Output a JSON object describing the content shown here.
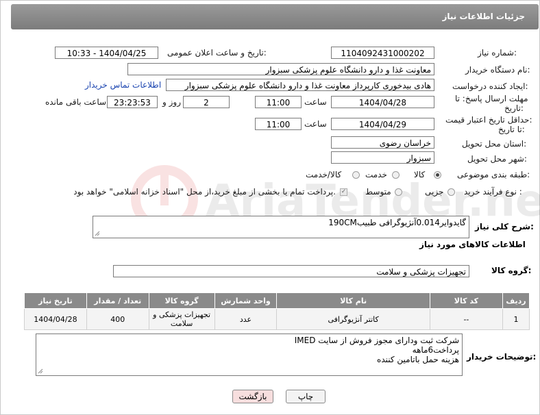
{
  "page": {
    "title": "جزئیات اطلاعات نیاز"
  },
  "form": {
    "need_number_label": "شماره نیاز:",
    "need_number": "1104092431000202",
    "announce_label": "تاریخ و ساعت اعلان عمومی:",
    "announce_value": "1404/04/25 - 10:33",
    "buyer_org_label": "نام دستگاه خریدار:",
    "buyer_org": "معاونت غذا و دارو   دانشگاه علوم پزشکی سبزوار",
    "creator_label": "ایجاد کننده درخواست:",
    "creator": "هادی بیدخوری کارپرداز معاونت غذا و دارو   دانشگاه علوم پزشکی سبزوار",
    "contact_link": "اطلاعات تماس خریدار",
    "deadline_label_1": "مهلت ارسال پاسخ: تا",
    "deadline_label_2": "تاریخ:",
    "deadline_date": "1404/04/28",
    "time_label": "ساعت",
    "deadline_time": "11:00",
    "days_count": "2",
    "days_label": "روز و",
    "remaining_time": "23:23:53",
    "remaining_label": "ساعت باقی مانده",
    "min_validity_label_1": "حداقل تاریخ اعتبار قیمت:",
    "min_validity_label_2": "تا تاریخ:",
    "validity_date": "1404/04/29",
    "validity_time": "11:00",
    "province_label": "استان محل تحویل:",
    "province": "خراسان رضوی",
    "city_label": "شهر محل تحویل:",
    "city": "سبزوار",
    "category_label": "طبقه بندی موضوعی:",
    "category_options": [
      "کالا",
      "خدمت",
      "کالا/خدمت"
    ],
    "purchase_type_label": "نوع فرآیند خرید :",
    "purchase_options": [
      "جزیی",
      "متوسط"
    ],
    "payment_note": "پرداخت تمام یا بخشی از مبلغ خرید،از محل \"اسناد خزانه اسلامی\" خواهد بود.",
    "summary_label": "شرح کلی نیاز:",
    "summary": "گایدوایر0.014آنژیوگرافی طبیب190CM"
  },
  "goods": {
    "section_title": "اطلاعات کالاهای مورد نیاز",
    "group_label": "گروه کالا:",
    "group_value": "تجهیزات پزشکی و سلامت",
    "columns": [
      "ردیف",
      "کد کالا",
      "نام کالا",
      "واحد شمارش",
      "گروه کالا",
      "تعداد / مقدار",
      "تاریخ نیاز"
    ],
    "rows": [
      [
        "1",
        "--",
        "کاتتر آنژیوگرافی",
        "عدد",
        "تجهیزات پزشکی و سلامت",
        "400",
        "1404/04/28"
      ]
    ]
  },
  "buyer_notes": {
    "label": "توضیحات خریدار:",
    "lines": [
      "شرکت ثبت ودارای مجوز فروش از سایت IMED",
      "پرداخت6ماهه",
      "هزینه حمل باتامین کننده"
    ]
  },
  "buttons": {
    "print": "چاپ",
    "back": "بازگشت"
  },
  "colors": {
    "header_bg": "#8a8a8a",
    "link": "#1a44b0",
    "back_button_bg": "#f7dede"
  }
}
